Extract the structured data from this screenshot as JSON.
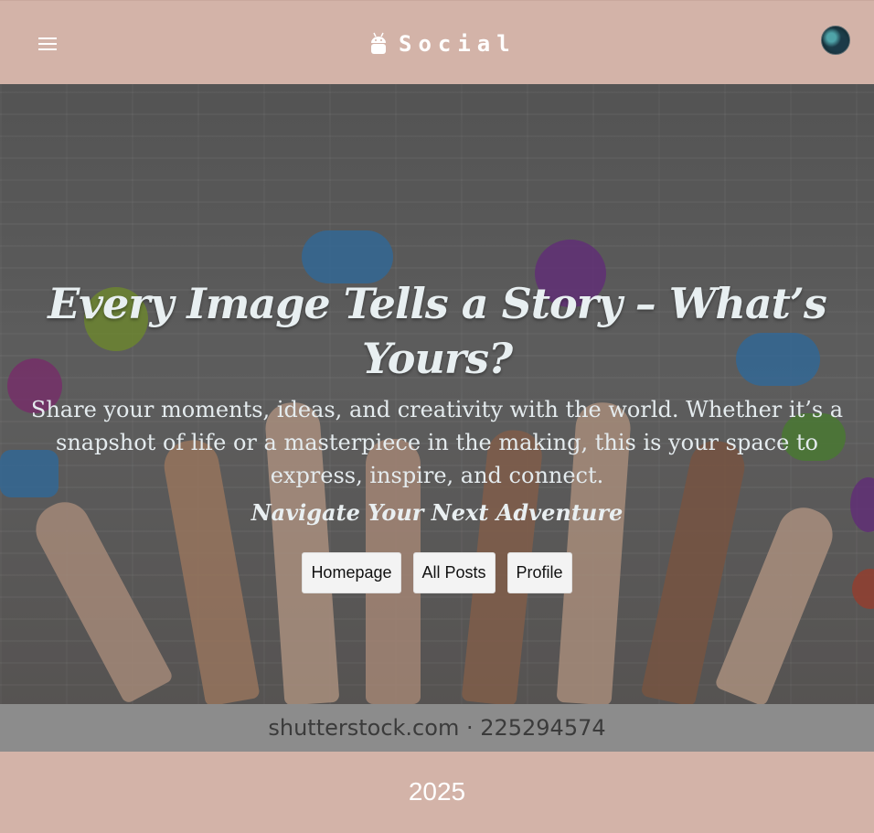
{
  "header": {
    "brand": "Social",
    "menu_icon": "hamburger-menu-icon",
    "brand_icon": "android-icon",
    "avatar": "user-avatar"
  },
  "hero": {
    "title": "Every Image Tells a Story – What’s Yours?",
    "description": "Share your moments, ideas, and creativity with the world. Whether it’s a snapshot of life or a masterpiece in the making, this is your space to express, inspire, and connect.",
    "subtitle": "Navigate Your Next Adventure",
    "buttons": [
      "Homepage",
      "All Posts",
      "Profile"
    ],
    "watermark": "shutterstock.com · 225294574"
  },
  "footer": {
    "year": "2025"
  },
  "colors": {
    "bar": "#d3b3a8",
    "button_bg": "#f3f3f3",
    "text_light": "#e8eff1"
  }
}
